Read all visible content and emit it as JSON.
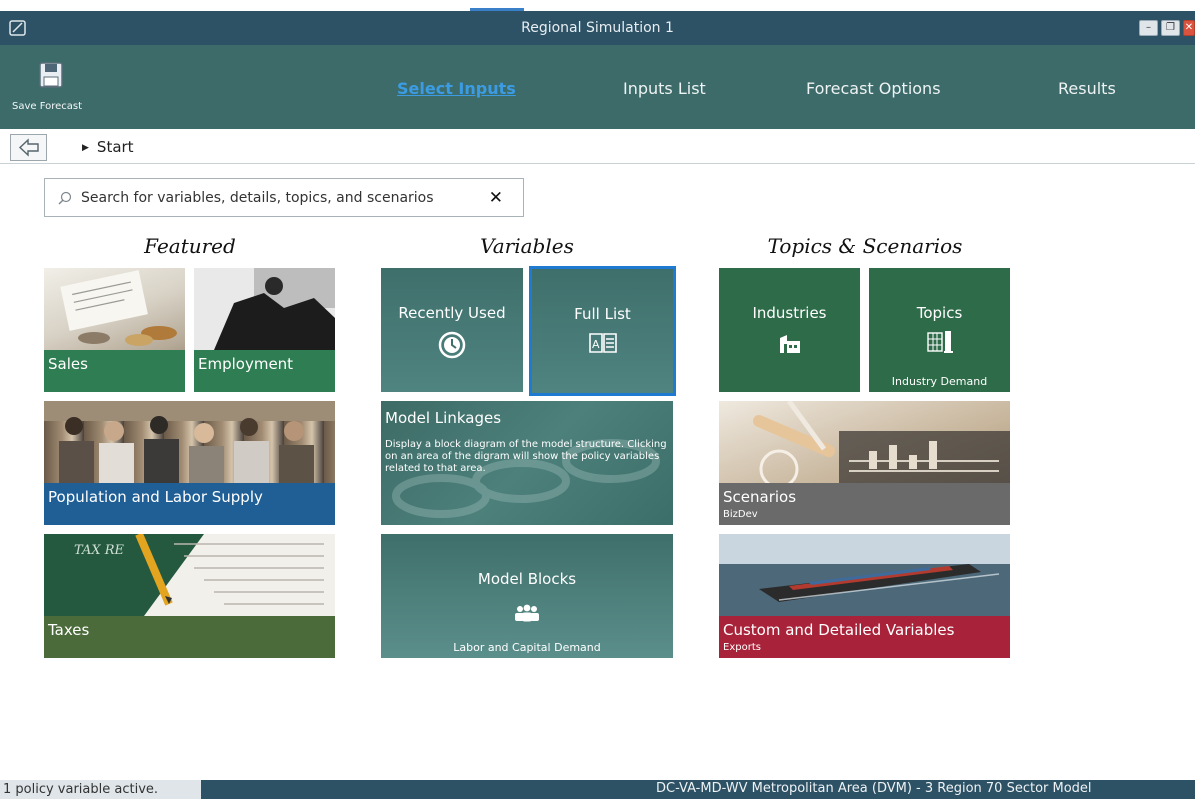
{
  "window": {
    "title": "Regional Simulation 1",
    "controls": [
      "minimize",
      "restore",
      "close"
    ]
  },
  "ribbon": {
    "save_label": "Save Forecast",
    "tabs": [
      {
        "label": "Select Inputs",
        "active": true
      },
      {
        "label": "Inputs List",
        "active": false
      },
      {
        "label": "Forecast Options",
        "active": false
      },
      {
        "label": "Results",
        "active": false
      }
    ]
  },
  "breadcrumb": {
    "current": "Start"
  },
  "search": {
    "placeholder": "Search for variables, details, topics, and scenarios",
    "clear_glyph": "✕"
  },
  "sections": {
    "featured": "Featured",
    "variables": "Variables",
    "topics": "Topics & Scenarios"
  },
  "featured_tiles": {
    "sales": "Sales",
    "employment": "Employment",
    "population": "Population and Labor Supply",
    "taxes": "Taxes"
  },
  "variable_tiles": {
    "recently_used": "Recently Used",
    "full_list": "Full List",
    "linkages_title": "Model Linkages",
    "linkages_desc": "Display a block diagram of the model structure.  Clicking on an area of the digram will show the policy variables related to that area.",
    "blocks_title": "Model Blocks",
    "blocks_sub": "Labor and Capital Demand"
  },
  "topic_tiles": {
    "industries": "Industries",
    "topics": "Topics",
    "topics_sub": "Industry Demand",
    "scenarios": "Scenarios",
    "scenarios_sub": "BizDev",
    "custom": "Custom and Detailed Variables",
    "custom_sub": "Exports"
  },
  "status": {
    "left": "1 policy variable active.",
    "right": "DC-VA-MD-WV Metropolitan Area (DVM) -  3 Region 70 Sector Model"
  },
  "colors": {
    "titlebar": "#2d5266",
    "ribbon": "#3d6b6a",
    "active_tab": "#3b9ce4",
    "tile_teal": "#3f6f6b",
    "tile_green": "#2d6b49",
    "selected_border": "#1f7ad1"
  }
}
